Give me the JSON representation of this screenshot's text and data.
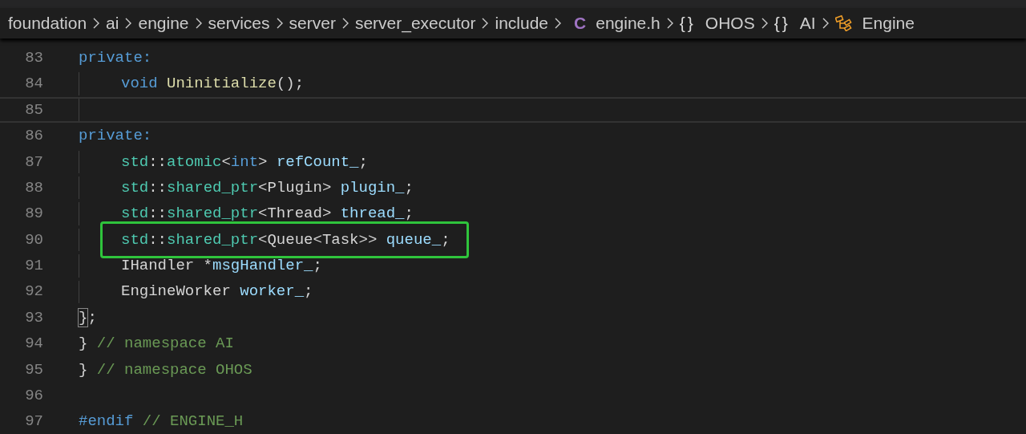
{
  "breadcrumb": [
    {
      "label": "foundation",
      "kind": "folder"
    },
    {
      "label": "ai",
      "kind": "folder"
    },
    {
      "label": "engine",
      "kind": "folder"
    },
    {
      "label": "services",
      "kind": "folder"
    },
    {
      "label": "server",
      "kind": "folder"
    },
    {
      "label": "server_executor",
      "kind": "folder"
    },
    {
      "label": "include",
      "kind": "folder"
    },
    {
      "label": "engine.h",
      "kind": "file",
      "icon_text": "C"
    },
    {
      "label": "OHOS",
      "kind": "namespace",
      "icon_text": "{}"
    },
    {
      "label": "AI",
      "kind": "namespace",
      "icon_text": "{}"
    },
    {
      "label": "Engine",
      "kind": "class"
    }
  ],
  "editor": {
    "lines": [
      {
        "number": "83",
        "current": false,
        "highlighted": false,
        "indented": false,
        "tokens": [
          {
            "text": "private:",
            "kind": "keyword"
          }
        ]
      },
      {
        "number": "84",
        "current": false,
        "highlighted": false,
        "indented": true,
        "tokens": [
          {
            "text": "void",
            "kind": "keyword"
          },
          {
            "text": " Uninitialize",
            "kind": "function"
          },
          {
            "text": "();",
            "kind": "plain"
          }
        ]
      },
      {
        "number": "85",
        "current": true,
        "highlighted": false,
        "indented": true
      },
      {
        "number": "86",
        "current": false,
        "highlighted": false,
        "indented": false,
        "tokens": [
          {
            "text": "private:",
            "kind": "keyword"
          }
        ]
      },
      {
        "number": "87",
        "current": false,
        "highlighted": false,
        "indented": true,
        "tokens": [
          {
            "text": "std",
            "kind": "type"
          },
          {
            "text": "::",
            "kind": "plain"
          },
          {
            "text": "atomic",
            "kind": "type"
          },
          {
            "text": "<",
            "kind": "plain"
          },
          {
            "text": "int",
            "kind": "keyword"
          },
          {
            "text": "> ",
            "kind": "plain"
          },
          {
            "text": "refCount_",
            "kind": "variable"
          },
          {
            "text": ";",
            "kind": "plain"
          }
        ]
      },
      {
        "number": "88",
        "current": false,
        "highlighted": false,
        "indented": true,
        "tokens": [
          {
            "text": "std",
            "kind": "type"
          },
          {
            "text": "::",
            "kind": "plain"
          },
          {
            "text": "shared_ptr",
            "kind": "type"
          },
          {
            "text": "<Plugin> ",
            "kind": "plain"
          },
          {
            "text": "plugin_",
            "kind": "variable"
          },
          {
            "text": ";",
            "kind": "plain"
          }
        ]
      },
      {
        "number": "89",
        "current": false,
        "highlighted": false,
        "indented": true,
        "tokens": [
          {
            "text": "std",
            "kind": "type"
          },
          {
            "text": "::",
            "kind": "plain"
          },
          {
            "text": "shared_ptr",
            "kind": "type"
          },
          {
            "text": "<Thread> ",
            "kind": "plain"
          },
          {
            "text": "thread_",
            "kind": "variable"
          },
          {
            "text": ";",
            "kind": "plain"
          }
        ]
      },
      {
        "number": "90",
        "current": false,
        "highlighted": true,
        "indented": true,
        "tokens": [
          {
            "text": "std",
            "kind": "type"
          },
          {
            "text": "::",
            "kind": "plain"
          },
          {
            "text": "shared_ptr",
            "kind": "type"
          },
          {
            "text": "<Queue<Task>> ",
            "kind": "plain"
          },
          {
            "text": "queue_",
            "kind": "variable"
          },
          {
            "text": ";",
            "kind": "plain"
          }
        ]
      },
      {
        "number": "91",
        "current": false,
        "highlighted": false,
        "indented": true,
        "tokens": [
          {
            "text": "IHandler *",
            "kind": "plain"
          },
          {
            "text": "msgHandler_",
            "kind": "variable"
          },
          {
            "text": ";",
            "kind": "plain"
          }
        ]
      },
      {
        "number": "92",
        "current": false,
        "highlighted": false,
        "indented": true,
        "tokens": [
          {
            "text": "EngineWorker ",
            "kind": "plain"
          },
          {
            "text": "worker_",
            "kind": "variable"
          },
          {
            "text": ";",
            "kind": "plain"
          }
        ]
      },
      {
        "number": "93",
        "current": false,
        "highlighted": false,
        "indented": false,
        "tokens": [
          {
            "text": "}",
            "kind": "bracket_match"
          },
          {
            "text": ";",
            "kind": "plain"
          }
        ]
      },
      {
        "number": "94",
        "current": false,
        "highlighted": false,
        "indented": false,
        "tokens": [
          {
            "text": "} ",
            "kind": "plain"
          },
          {
            "text": "// namespace AI",
            "kind": "comment"
          }
        ]
      },
      {
        "number": "95",
        "current": false,
        "highlighted": false,
        "indented": false,
        "tokens": [
          {
            "text": "} ",
            "kind": "plain"
          },
          {
            "text": "// namespace OHOS",
            "kind": "comment"
          }
        ]
      },
      {
        "number": "96",
        "current": false,
        "highlighted": false,
        "indented": false
      },
      {
        "number": "97",
        "current": false,
        "highlighted": false,
        "indented": false,
        "tokens": [
          {
            "text": "#endif",
            "kind": "keyword"
          },
          {
            "text": " // ENGINE_H",
            "kind": "comment"
          }
        ]
      }
    ]
  }
}
